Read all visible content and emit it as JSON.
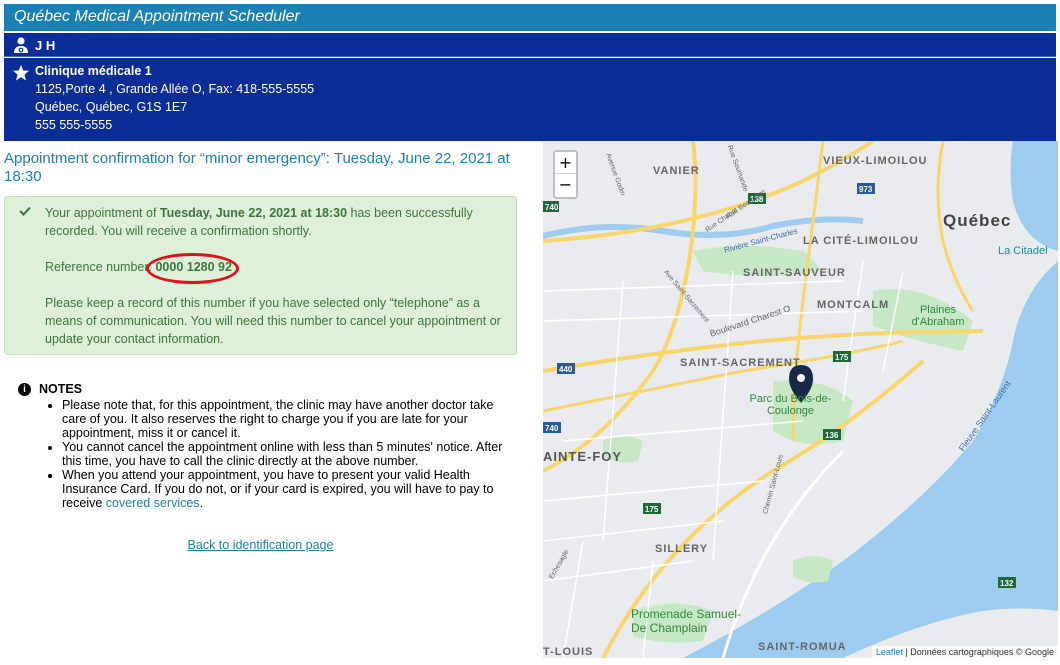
{
  "header": {
    "title": "Québec Medical Appointment Scheduler"
  },
  "user": {
    "initials": "J H",
    "icon": "user-doctor-icon"
  },
  "clinic": {
    "name": "Clinique médicale 1",
    "address_line": "1125,Porte 4 , Grande Allée O, Fax: 418-555-5555",
    "city_line": "Québec, Québec, G1S 1E7",
    "phone": "555 555-5555",
    "icon": "star-icon"
  },
  "confirmation": {
    "title": "Appointment confirmation for “minor emergency”: Tuesday, June 22, 2021 at 18:30",
    "p1_prefix": "Your appointment of ",
    "p1_date": "Tuesday, June 22, 2021 at 18:30",
    "p1_suffix": " has been successfully recorded. You will receive a confirmation shortly.",
    "ref_label": "Reference number: ",
    "ref_number": "0000 1280 92",
    "p3": "Please keep a record of this number if you have selected only “telephone” as a means of communication. You will need this number to cancel your appointment or update your contact information.",
    "accent_color": "#3c763d",
    "highlight_color": "#e0111a"
  },
  "notes": {
    "heading": "NOTES",
    "items": [
      "Please note that, for this appointment, the clinic may have another doctor take care of you. It also reserves the right to charge you if you are late for your appointment, miss it or cancel it.",
      "You cannot cancel the appointment online with less than 5 minutes' notice. After this time, you have to call the clinic directly at the above number.",
      "When you attend your appointment, you have to present your valid Health Insurance Card. If you do not, or if your card is expired, you will have to pay to receive "
    ],
    "link": "covered services",
    "link_suffix": "."
  },
  "back_link": "Back to identification page",
  "map": {
    "zoom_in": "+",
    "zoom_out": "−",
    "attribution_link": "Leaflet",
    "attribution_text": " | Données cartographiques © Google",
    "labels": {
      "vanier": "VANIER",
      "vieux_limoilou": "VIEUX-LIMOILOU",
      "quebec": "Québec",
      "citadel": "La Citadel",
      "cite_limoilou": "LA CITÉ-LIMOILOU",
      "saint_sauveur": "SAINT-SAUVEUR",
      "montcalm": "MONTCALM",
      "plaines": "Plaines d'Abraham",
      "saint_sacrement": "SAINT-SACREMENT",
      "parc": "Parc du Bois-de-Coulonge",
      "fleuve": "Fleuve Saint-Laurent",
      "sainte_foy": "AINTE-FOY",
      "sillery": "SILLERY",
      "promenade": "Promenade Samuel-De Champlain",
      "saint_romuald": "SAINT-ROMUA",
      "saint_louis": "T-LOUIS",
      "riviere": "Rivière Saint-Charles",
      "bd_charest": "Boulevard Charest O",
      "rue_beaucage": "Rue Beaucage",
      "rue_chabot": "Rue Chabot",
      "avenue_godin": "Avenue Godin",
      "rue_soumande": "Rue Soumande",
      "ave_saint_sacrement": "Ave Saint-Sacrement",
      "chemin_saint_louis": "Chemin Saint-Louis",
      "route_gauche": "Echesagle"
    },
    "route_numbers": [
      "740",
      "973",
      "138",
      "440",
      "175",
      "740",
      "136",
      "175",
      "132",
      "175"
    ]
  }
}
